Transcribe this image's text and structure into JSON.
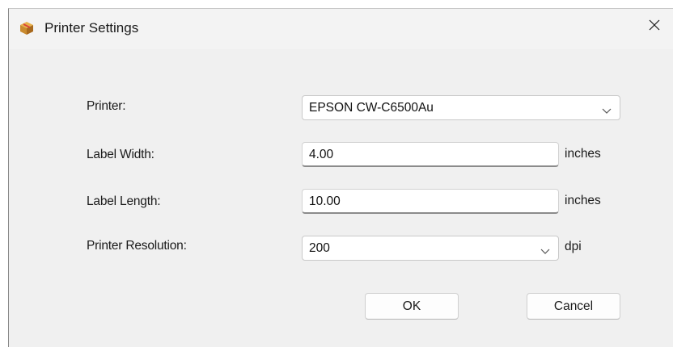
{
  "window": {
    "title": "Printer Settings",
    "app_icon": "package-box-icon",
    "close_icon": "close-icon"
  },
  "form": {
    "printer": {
      "label": "Printer:",
      "value": "EPSON CW-C6500Au"
    },
    "label_width": {
      "label": "Label Width:",
      "value": "4.00",
      "unit": "inches"
    },
    "label_length": {
      "label": "Label Length:",
      "value": "10.00",
      "unit": "inches"
    },
    "printer_resolution": {
      "label": "Printer Resolution:",
      "value": "200",
      "unit": "dpi"
    }
  },
  "buttons": {
    "ok_label": "OK",
    "cancel_label": "Cancel"
  }
}
